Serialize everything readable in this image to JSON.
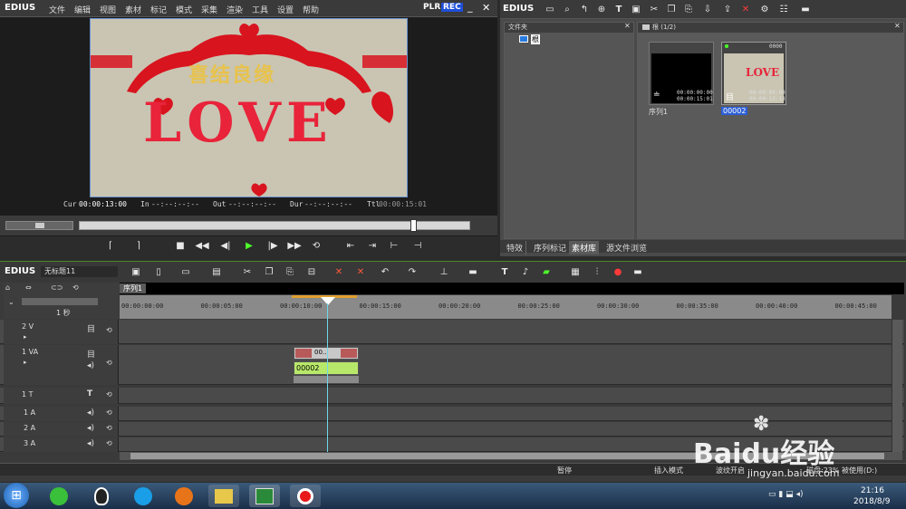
{
  "player": {
    "logo": "EDIUS",
    "menu": [
      "文件",
      "编辑",
      "视图",
      "素材",
      "标记",
      "模式",
      "采集",
      "渲染",
      "工具",
      "设置",
      "帮助"
    ],
    "plr_label": "PLR",
    "rec_label": "REC",
    "preview_text": "LOVE",
    "banner_text": "喜结良缘",
    "timecodes": {
      "cur_label": "Cur",
      "cur": "00:00:13:00",
      "in_label": "In",
      "in": "--:--:--:--",
      "out_label": "Out",
      "out": "--:--:--:--",
      "dur_label": "Dur",
      "dur": "--:--:--:--",
      "ttl_label": "Ttl",
      "ttl": "00:00:15:01"
    }
  },
  "bin": {
    "logo": "EDIUS",
    "folder_header": "文件夹",
    "folder_root": "根",
    "bin_header": "根 (1/2)",
    "clips": [
      {
        "name": "序列1",
        "tc_in": "00:00:00:00",
        "tc_out": "00:00:15:01",
        "badge": ""
      },
      {
        "name": "00002",
        "tc_in": "00:00:09:09",
        "tc_out": "00:00:13:13",
        "badge": "0000"
      }
    ],
    "tabs": [
      "特效",
      "序列标记",
      "素材库",
      "源文件浏览"
    ]
  },
  "timeline": {
    "logo": "EDIUS",
    "project_name": "无标题11",
    "sequence_tab": "序列1",
    "scale_label": "1 秒",
    "ruler_ticks": [
      "00:00:00:00",
      "00:00:05:00",
      "00:00:10:00",
      "00:00:15:00",
      "00:00:20:00",
      "00:00:25:00",
      "00:00:30:00",
      "00:00:35:00",
      "00:00:40:00",
      "00:00:45:00"
    ],
    "tracks": [
      {
        "label": "2 V",
        "type": "video"
      },
      {
        "label": "1 VA",
        "type": "va"
      },
      {
        "label": "1 T",
        "type": "title"
      },
      {
        "label": "1 A",
        "type": "audio"
      },
      {
        "label": "2 A",
        "type": "audio"
      },
      {
        "label": "3 A",
        "type": "audio"
      }
    ],
    "clip_label": "00002",
    "clip_thumb_label": "00...",
    "status": {
      "state": "暂停",
      "mode": "插入模式",
      "ripple": "波纹开启",
      "disk": "磁盘:23% 被使用(D:)"
    }
  },
  "taskbar": {
    "time": "21:16",
    "date": "2018/8/9"
  },
  "watermark": {
    "brand": "Baidu经验",
    "url": "jingyan.baidu.com"
  },
  "colors": {
    "accent_green": "#4cff2a",
    "rec_blue": "#1e4fd8",
    "clip_green": "#b8e86a",
    "playhead": "#6fd8e8"
  }
}
